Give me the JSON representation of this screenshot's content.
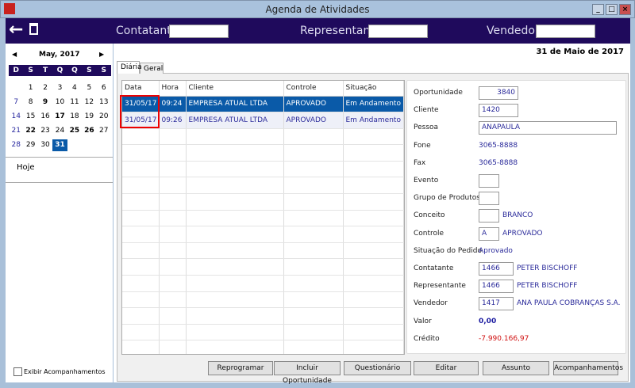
{
  "window": {
    "title": "Agenda de Atividades"
  },
  "toolbar": {
    "contatante_label": "Contatante",
    "representante_label": "Representante",
    "vendedor_label": "Vendedor",
    "contatante_value": "",
    "representante_value": "",
    "vendedor_value": ""
  },
  "calendar": {
    "month": "May, 2017",
    "weekdays": [
      "D",
      "S",
      "T",
      "Q",
      "Q",
      "S",
      "S"
    ],
    "days": [
      "1",
      "2",
      "3",
      "4",
      "5",
      "6",
      "7",
      "8",
      "9",
      "10",
      "11",
      "12",
      "13",
      "14",
      "15",
      "16",
      "17",
      "18",
      "19",
      "20",
      "21",
      "22",
      "23",
      "24",
      "25",
      "26",
      "27",
      "28",
      "29",
      "30",
      "31"
    ],
    "selected": "31",
    "today_label": "Hoje"
  },
  "show_followups_label": "Exibir Acompanhamentos",
  "date_heading": "31 de Maio de 2017",
  "tabs": [
    "Diária",
    "Geral"
  ],
  "grid": {
    "columns": [
      "Data",
      "Hora",
      "Cliente",
      "Controle",
      "Situação"
    ],
    "rows": [
      [
        "31/05/17",
        "09:24",
        "EMPRESA ATUAL LTDA",
        "APROVADO",
        "Em Andamento"
      ],
      [
        "31/05/17",
        "09:26",
        "EMPRESA ATUAL LTDA",
        "APROVADO",
        "Em Andamento"
      ]
    ]
  },
  "detail": {
    "oportunidade": {
      "label": "Oportunidade",
      "value": "3840"
    },
    "cliente": {
      "label": "Cliente",
      "value": "1420"
    },
    "pessoa": {
      "label": "Pessoa",
      "value": "ANAPAULA"
    },
    "fone": {
      "label": "Fone",
      "value": "3065-8888"
    },
    "fax": {
      "label": "Fax",
      "value": "3065-8888"
    },
    "evento": {
      "label": "Evento",
      "value": ""
    },
    "grupo": {
      "label": "Grupo de Produtos",
      "value": ""
    },
    "conceito": {
      "label": "Conceito",
      "value": "",
      "desc": "BRANCO"
    },
    "controle": {
      "label": "Controle",
      "value": "A",
      "desc": "APROVADO"
    },
    "situacao": {
      "label": "Situação do Pedido",
      "value": "Aprovado"
    },
    "contatante": {
      "label": "Contatante",
      "value": "1466",
      "desc": "PETER BISCHOFF"
    },
    "representante": {
      "label": "Representante",
      "value": "1466",
      "desc": "PETER BISCHOFF"
    },
    "vendedor": {
      "label": "Vendedor",
      "value": "1417",
      "desc": "ANA PAULA COBRANÇAS S.A."
    },
    "valor": {
      "label": "Valor",
      "value": "0,00"
    },
    "credito": {
      "label": "Crédito",
      "value": "-7.990.166,97"
    }
  },
  "buttons": [
    "Reprogramar",
    "Incluir Oportunidade",
    "Questionário",
    "Editar",
    "Assunto",
    "Acompanhamentos"
  ],
  "colors": {
    "navy": "#1f0a5c",
    "selection": "#0a5aa8",
    "negative": "#d01010"
  }
}
